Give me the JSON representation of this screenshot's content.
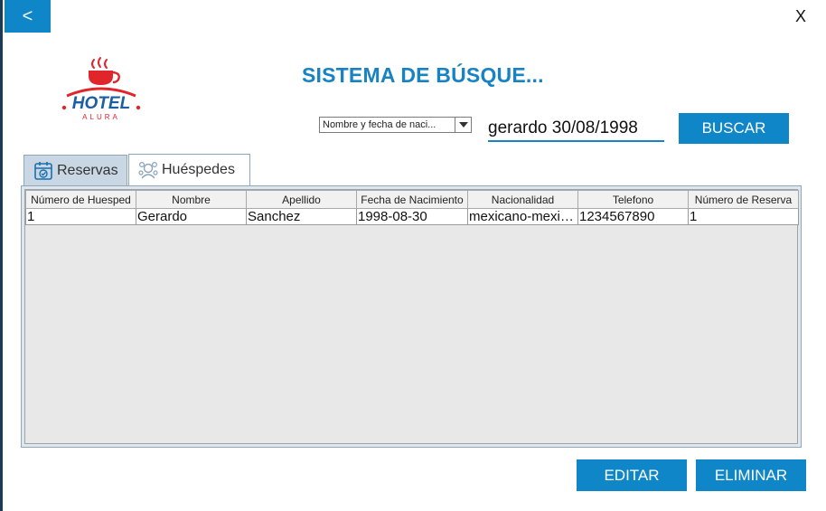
{
  "window": {
    "back_label": "<",
    "close_label": "X",
    "title": "SISTEMA DE BÚSQUE..."
  },
  "logo": {
    "name": "HOTEL",
    "sub": "ALURA"
  },
  "search": {
    "criteria_value": "Nombre y fecha de naci...",
    "query_value": "gerardo 30/08/1998",
    "button_label": "BUSCAR"
  },
  "tabs": [
    {
      "label": "Reservas",
      "icon": "calendar-check-icon",
      "selected": false
    },
    {
      "label": "Huéspedes",
      "icon": "guests-icon",
      "selected": true
    }
  ],
  "table": {
    "columns": [
      "Número de Huesped",
      "Nombre",
      "Apellido",
      "Fecha de Nacimiento",
      "Nacionalidad",
      "Telefono",
      "Número de Reserva"
    ],
    "rows": [
      [
        "1",
        "Gerardo",
        "Sanchez",
        "1998-08-30",
        "mexicano-mexicana",
        "1234567890",
        "1"
      ]
    ]
  },
  "actions": {
    "edit_label": "EDITAR",
    "delete_label": "ELIMINAR"
  },
  "colors": {
    "accent": "#0f86c8",
    "title": "#1783c4",
    "logo_red": "#e0252b"
  }
}
